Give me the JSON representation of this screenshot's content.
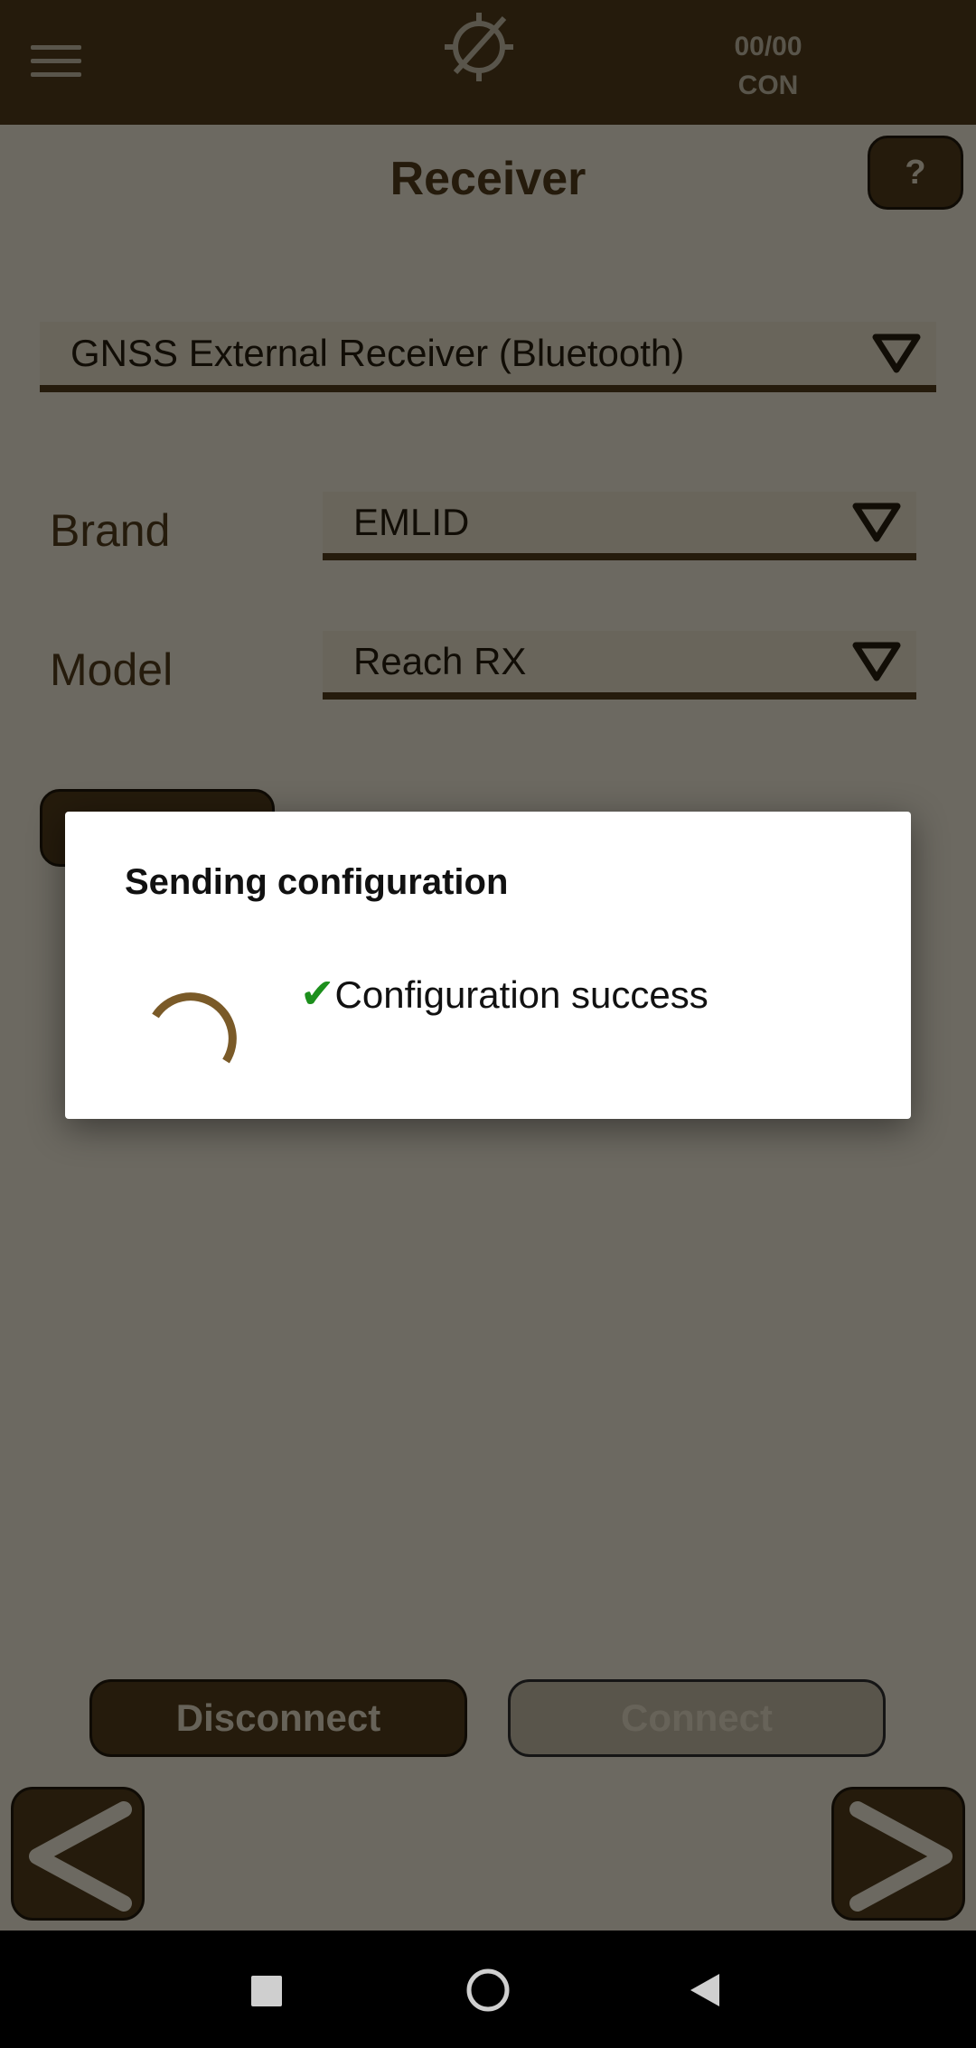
{
  "topbar": {
    "sat_count": "00/00",
    "connection_status": "CON",
    "icons": [
      "menu-icon",
      "gps-disabled-icon"
    ]
  },
  "page": {
    "title": "Receiver",
    "help_label": "?"
  },
  "receiver_type": {
    "value": "GNSS External Receiver (Bluetooth)"
  },
  "brand": {
    "label": "Brand",
    "value": "EMLID"
  },
  "model": {
    "label": "Model",
    "value": "Reach RX"
  },
  "buttons": {
    "disconnect": "Disconnect",
    "connect": "Connect"
  },
  "dialog": {
    "title": "Sending configuration",
    "check": "✔",
    "message": "Configuration success"
  },
  "colors": {
    "brand_dark": "#4a3718",
    "background": "#d9d3c3",
    "accent_spinner": "#7a5a28",
    "success": "#1c8f1c"
  }
}
